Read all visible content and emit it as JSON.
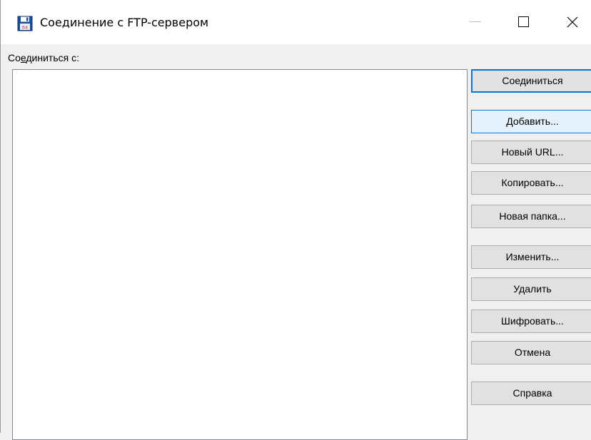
{
  "window": {
    "title": "Соединение с FTP-сервером"
  },
  "connect_to_label": {
    "before": "Со",
    "underlined": "е",
    "after": "диниться с:"
  },
  "buttons": {
    "connect": "Соединиться",
    "add": "Добавить...",
    "new_url": "Новый URL...",
    "copy": "Копировать...",
    "new_folder": "Новая папка...",
    "edit": "Изменить...",
    "delete": "Удалить",
    "encrypt": "Шифровать...",
    "cancel": "Отмена",
    "help": "Справка"
  },
  "icons": {
    "app": "floppy-disk-icon",
    "minimize": "minimize-icon",
    "maximize": "maximize-icon",
    "close": "close-icon"
  },
  "colors": {
    "accent": "#0078d7",
    "button_face": "#e1e1e1",
    "hover_face": "#e5f1fb",
    "window_bg": "#f0f0f0"
  }
}
